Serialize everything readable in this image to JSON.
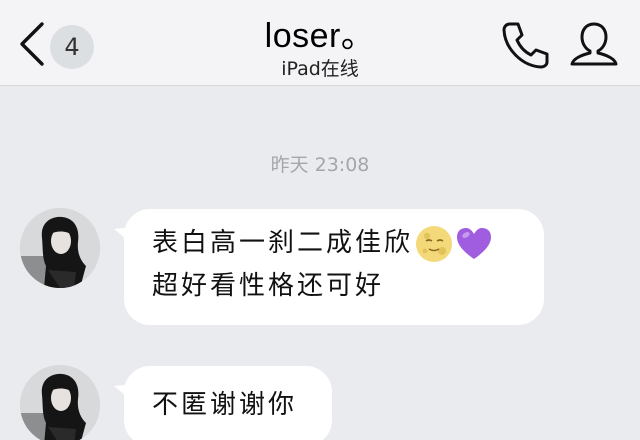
{
  "header": {
    "back_badge_count": "4",
    "title": "loser。",
    "subtitle": "iPad在线",
    "back_icon": "chevron-left",
    "call_icon": "phone-handset",
    "profile_icon": "user-outline"
  },
  "chat": {
    "timestamp": "昨天 23:08",
    "messages": [
      {
        "sender": "contact",
        "lines": [
          "表白高一刹二成佳欣",
          "超好看性格还可好"
        ],
        "emojis": [
          "full-moon-face",
          "purple-heart"
        ]
      },
      {
        "sender": "contact",
        "lines": [
          "不匿谢谢你"
        ],
        "emojis": []
      }
    ]
  },
  "colors": {
    "background": "#e9ebef",
    "header": "#f4f4f6",
    "bubble": "#ffffff",
    "timestamp": "#a3a6aa",
    "badge": "#dcdfe2",
    "purple_heart": "#a05de0"
  }
}
